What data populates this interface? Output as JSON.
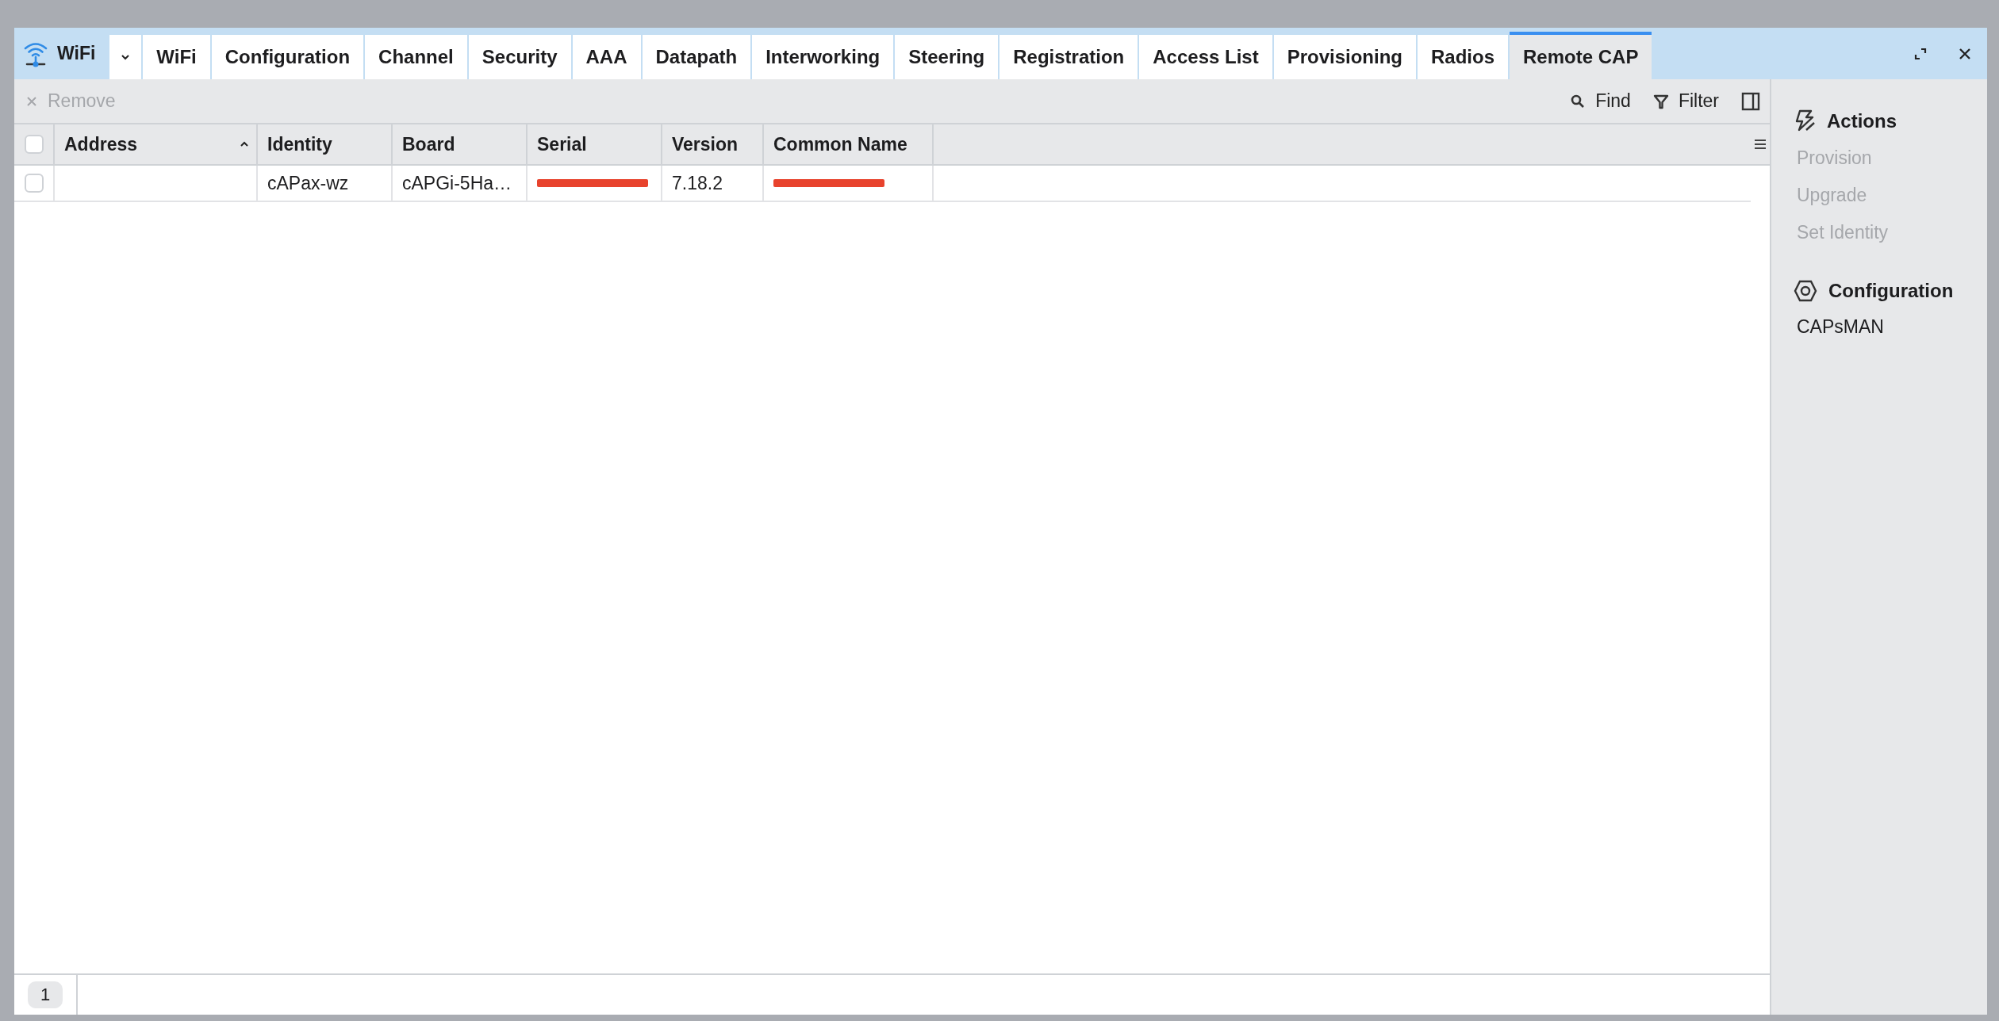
{
  "window": {
    "title": "WiFi"
  },
  "tabs": [
    {
      "label": "WiFi",
      "selected": false
    },
    {
      "label": "Configuration",
      "selected": false
    },
    {
      "label": "Channel",
      "selected": false
    },
    {
      "label": "Security",
      "selected": false
    },
    {
      "label": "AAA",
      "selected": false
    },
    {
      "label": "Datapath",
      "selected": false
    },
    {
      "label": "Interworking",
      "selected": false
    },
    {
      "label": "Steering",
      "selected": false
    },
    {
      "label": "Registration",
      "selected": false
    },
    {
      "label": "Access List",
      "selected": false
    },
    {
      "label": "Provisioning",
      "selected": false
    },
    {
      "label": "Radios",
      "selected": false
    },
    {
      "label": "Remote CAP",
      "selected": true
    }
  ],
  "toolbar": {
    "remove": {
      "label": "Remove",
      "disabled": true
    },
    "find": "Find",
    "filter": "Filter"
  },
  "table": {
    "all_checked": false,
    "columns": [
      {
        "label": "Address",
        "sorted": true
      },
      {
        "label": "Identity",
        "sorted": false
      },
      {
        "label": "Board",
        "sorted": false
      },
      {
        "label": "Serial",
        "sorted": false
      },
      {
        "label": "Version",
        "sorted": false
      },
      {
        "label": "Common Name",
        "sorted": false
      }
    ],
    "rows": [
      {
        "checked": false,
        "cells": [
          {
            "text": "",
            "redacted": false
          },
          {
            "text": "cAPax-wz",
            "redacted": false
          },
          {
            "text": "cAPGi-5Ha…",
            "redacted": false
          },
          {
            "text": "",
            "redacted": true
          },
          {
            "text": "7.18.2",
            "redacted": false
          },
          {
            "text": "",
            "redacted": true
          }
        ]
      }
    ]
  },
  "sidebar": {
    "sections": [
      {
        "kind": "actions",
        "title": "Actions",
        "items": [
          {
            "label": "Provision",
            "disabled": true
          },
          {
            "label": "Upgrade",
            "disabled": true
          },
          {
            "label": "Set Identity",
            "disabled": true
          }
        ]
      },
      {
        "kind": "configuration",
        "title": "Configuration",
        "items": [
          {
            "label": "CAPsMAN",
            "disabled": false
          }
        ]
      }
    ]
  },
  "status_bar": {
    "count": "1"
  }
}
